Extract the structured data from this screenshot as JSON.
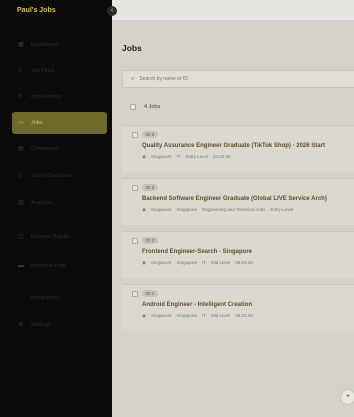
{
  "sidebar": {
    "brand": "Paul's Jobs",
    "collapse_icon": "chevron-left-icon",
    "items": [
      {
        "label": "Dashboard",
        "icon": "grid-icon"
      },
      {
        "label": "Job Feed",
        "icon": "feed-icon"
      },
      {
        "label": "Applications",
        "icon": "edit-icon"
      },
      {
        "label": "Jobs",
        "icon": "briefcase-icon",
        "active": true
      },
      {
        "label": "Companies",
        "icon": "building-icon"
      },
      {
        "label": "Saved Searches",
        "icon": "bookmark-icon"
      },
      {
        "label": "Analytics",
        "icon": "chart-icon"
      },
      {
        "label": "Resume Builder",
        "icon": "file-icon"
      },
      {
        "label": "Interview Prep",
        "icon": "message-icon"
      },
      {
        "label": "Integrations",
        "icon": "plug-icon"
      },
      {
        "label": "Settings",
        "icon": "gear-icon"
      }
    ]
  },
  "main": {
    "title": "Jobs",
    "search": {
      "placeholder": "Search by name or ID"
    },
    "count_label": "4 Jobs",
    "cards": [
      {
        "badge": "ID 4",
        "title": "Quality Assurance Engineer Graduate (TikTok Shop) - 2026 Start",
        "location": "Singapore",
        "type": "IT",
        "level": "Entry Level",
        "date": "24.04.26"
      },
      {
        "badge": "ID 3",
        "title": "Backend Software Engineer Graduate (Global LIVE Service Arch)",
        "location": "Singapore",
        "location2": "Singapore",
        "dept": "Engineering and Technical Jobs",
        "level": "Entry Level"
      },
      {
        "badge": "ID 2",
        "title": "Frontend Engineer-Search - Singapore",
        "location": "Singapore",
        "location2": "Singapore",
        "type": "IT",
        "level": "Mid Level",
        "date": "08.03.26"
      },
      {
        "badge": "ID 1",
        "title": "Android Engineer - Intelligent Creation",
        "location": "Singapore",
        "location2": "Singapore",
        "type": "IT",
        "level": "Mid Level",
        "date": "08.03.26"
      }
    ],
    "fab_icon": "plus-icon",
    "fab_label": "+"
  }
}
